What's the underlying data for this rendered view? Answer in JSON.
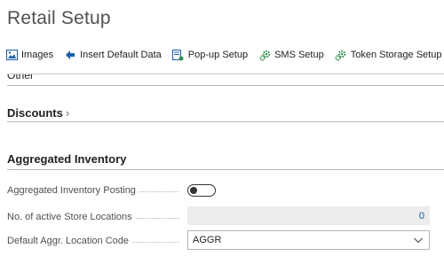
{
  "page": {
    "title": "Retail Setup"
  },
  "toolbar": {
    "actions": [
      {
        "label": "Images",
        "icon": "image-icon"
      },
      {
        "label": "Insert Default Data",
        "icon": "arrow-left-icon"
      },
      {
        "label": "Pop-up Setup",
        "icon": "popup-setup-icon"
      },
      {
        "label": "SMS Setup",
        "icon": "gears-icon"
      },
      {
        "label": "Token Storage Setup",
        "icon": "gears-icon"
      }
    ]
  },
  "sections": {
    "other": {
      "label": "Other"
    },
    "discounts": {
      "label": "Discounts",
      "chevron": "›"
    },
    "aggregated": {
      "label": "Aggregated Inventory"
    }
  },
  "fields": {
    "posting": {
      "label": "Aggregated Inventory Posting",
      "value": false
    },
    "active_locations": {
      "label": "No. of active Store Locations",
      "value": "0"
    },
    "location_code": {
      "label": "Default Aggr. Location Code",
      "value": "AGGR"
    }
  },
  "colors": {
    "accent": "#0a5bb3",
    "icon_green": "#2f8f4a",
    "icon_blue": "#1c5fa8"
  }
}
